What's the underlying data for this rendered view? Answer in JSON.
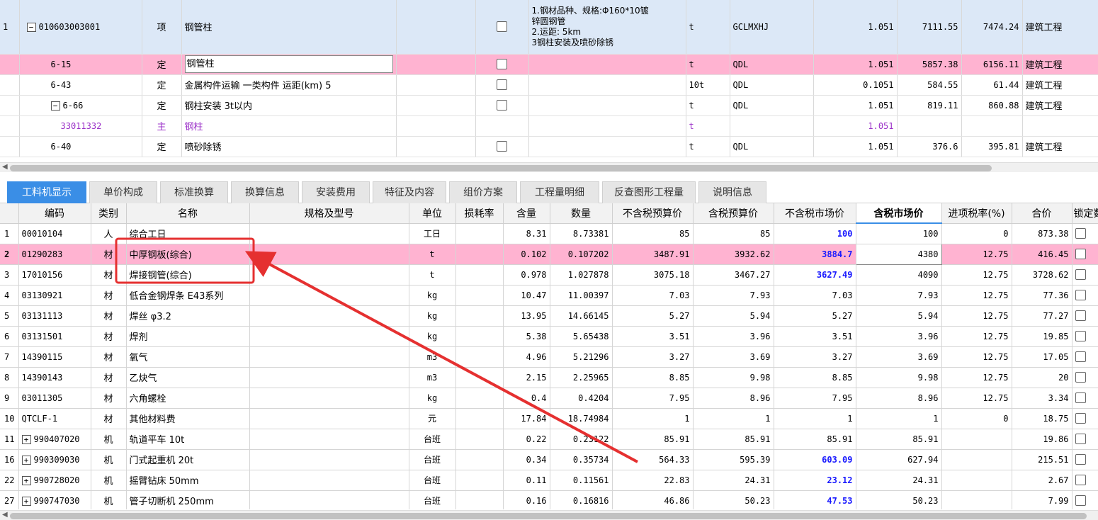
{
  "top_rows": [
    {
      "rownum": "1",
      "code": "010603003001",
      "type": "项",
      "name": "钢管柱",
      "desc": [
        "1.钢材品种、规格:Φ160*10镀",
        "锌圆钢管",
        "2.运距: 5km",
        "3钢柱安装及喷砂除锈"
      ],
      "unit": "t",
      "tag": "GCLMXHJ",
      "qty": "1.051",
      "price": "7111.55",
      "total": "7474.24",
      "category": "建筑工程"
    },
    {
      "rownum": "",
      "code": "6-15",
      "type": "定",
      "name": "钢管柱",
      "unit": "t",
      "tag": "QDL",
      "qty": "1.051",
      "price": "5857.38",
      "total": "6156.11",
      "category": "建筑工程"
    },
    {
      "rownum": "",
      "code": "6-43",
      "type": "定",
      "name": "金属构件运输 一类构件 运距(km) 5",
      "unit": "10t",
      "tag": "QDL",
      "qty": "0.1051",
      "price": "584.55",
      "total": "61.44",
      "category": "建筑工程"
    },
    {
      "rownum": "",
      "code": "6-66",
      "type": "定",
      "name": "钢柱安装 3t以内",
      "unit": "t",
      "tag": "QDL",
      "qty": "1.051",
      "price": "819.11",
      "total": "860.88",
      "category": "建筑工程"
    },
    {
      "rownum": "",
      "code": "33011332",
      "type": "主",
      "name": "钢柱",
      "unit": "t",
      "tag": "",
      "qty": "1.051",
      "price": "",
      "total": "",
      "category": ""
    },
    {
      "rownum": "",
      "code": "6-40",
      "type": "定",
      "name": "喷砂除锈",
      "unit": "t",
      "tag": "QDL",
      "qty": "1.051",
      "price": "376.6",
      "total": "395.81",
      "category": "建筑工程"
    }
  ],
  "tabs": [
    "工料机显示",
    "单价构成",
    "标准换算",
    "换算信息",
    "安装费用",
    "特征及内容",
    "组价方案",
    "工程量明细",
    "反查图形工程量",
    "说明信息"
  ],
  "columns": [
    "编码",
    "类别",
    "名称",
    "规格及型号",
    "单位",
    "损耗率",
    "含量",
    "数量",
    "不含税预算价",
    "含税预算价",
    "不含税市场价",
    "含税市场价",
    "进项税率(%)",
    "合价",
    "锁定数"
  ],
  "rows": [
    {
      "n": "1",
      "code": "00010104",
      "type": "人",
      "name": "综合工日",
      "unit": "工日",
      "content": "8.31",
      "qty": "8.73381",
      "p1": "85",
      "p2": "85",
      "p3": "100",
      "p4": "100",
      "tax": "0",
      "total": "873.38",
      "blue": true
    },
    {
      "n": "2",
      "code": "01290283",
      "type": "材",
      "name": "中厚钢板(综合)",
      "unit": "t",
      "content": "0.102",
      "qty": "0.107202",
      "p1": "3487.91",
      "p2": "3932.62",
      "p3": "3884.7",
      "p4": "4380",
      "tax": "12.75",
      "total": "416.45",
      "blue": true
    },
    {
      "n": "3",
      "code": "17010156",
      "type": "材",
      "name": "焊接钢管(综合)",
      "unit": "t",
      "content": "0.978",
      "qty": "1.027878",
      "p1": "3075.18",
      "p2": "3467.27",
      "p3": "3627.49",
      "p4": "4090",
      "tax": "12.75",
      "total": "3728.62",
      "blue": true
    },
    {
      "n": "4",
      "code": "03130921",
      "type": "材",
      "name": "低合金钢焊条 E43系列",
      "unit": "kg",
      "content": "10.47",
      "qty": "11.00397",
      "p1": "7.03",
      "p2": "7.93",
      "p3": "7.03",
      "p4": "7.93",
      "tax": "12.75",
      "total": "77.36",
      "blue": false
    },
    {
      "n": "5",
      "code": "03131113",
      "type": "材",
      "name": "焊丝 φ3.2",
      "unit": "kg",
      "content": "13.95",
      "qty": "14.66145",
      "p1": "5.27",
      "p2": "5.94",
      "p3": "5.27",
      "p4": "5.94",
      "tax": "12.75",
      "total": "77.27",
      "blue": false
    },
    {
      "n": "6",
      "code": "03131501",
      "type": "材",
      "name": "焊剂",
      "unit": "kg",
      "content": "5.38",
      "qty": "5.65438",
      "p1": "3.51",
      "p2": "3.96",
      "p3": "3.51",
      "p4": "3.96",
      "tax": "12.75",
      "total": "19.85",
      "blue": false
    },
    {
      "n": "7",
      "code": "14390115",
      "type": "材",
      "name": "氧气",
      "unit": "m3",
      "content": "4.96",
      "qty": "5.21296",
      "p1": "3.27",
      "p2": "3.69",
      "p3": "3.27",
      "p4": "3.69",
      "tax": "12.75",
      "total": "17.05",
      "blue": false
    },
    {
      "n": "8",
      "code": "14390143",
      "type": "材",
      "name": "乙炔气",
      "unit": "m3",
      "content": "2.15",
      "qty": "2.25965",
      "p1": "8.85",
      "p2": "9.98",
      "p3": "8.85",
      "p4": "9.98",
      "tax": "12.75",
      "total": "20",
      "blue": false
    },
    {
      "n": "9",
      "code": "03011305",
      "type": "材",
      "name": "六角螺栓",
      "unit": "kg",
      "content": "0.4",
      "qty": "0.4204",
      "p1": "7.95",
      "p2": "8.96",
      "p3": "7.95",
      "p4": "8.96",
      "tax": "12.75",
      "total": "3.34",
      "blue": false
    },
    {
      "n": "10",
      "code": "QTCLF-1",
      "type": "材",
      "name": "其他材料费",
      "unit": "元",
      "content": "17.84",
      "qty": "18.74984",
      "p1": "1",
      "p2": "1",
      "p3": "1",
      "p4": "1",
      "tax": "0",
      "total": "18.75",
      "blue": false
    },
    {
      "n": "11",
      "code": "990407020",
      "type": "机",
      "name": "轨道平车 10t",
      "unit": "台班",
      "content": "0.22",
      "qty": "0.23122",
      "p1": "85.91",
      "p2": "85.91",
      "p3": "85.91",
      "p4": "85.91",
      "tax": "",
      "total": "19.86",
      "blue": false,
      "expand": true
    },
    {
      "n": "16",
      "code": "990309030",
      "type": "机",
      "name": "门式起重机 20t",
      "unit": "台班",
      "content": "0.34",
      "qty": "0.35734",
      "p1": "564.33",
      "p2": "595.39",
      "p3": "603.09",
      "p4": "627.94",
      "tax": "",
      "total": "215.51",
      "blue": true,
      "expand": true
    },
    {
      "n": "22",
      "code": "990728020",
      "type": "机",
      "name": "摇臂钻床 50mm",
      "unit": "台班",
      "content": "0.11",
      "qty": "0.11561",
      "p1": "22.83",
      "p2": "24.31",
      "p3": "23.12",
      "p4": "24.31",
      "tax": "",
      "total": "2.67",
      "blue": true,
      "expand": true
    },
    {
      "n": "27",
      "code": "990747030",
      "type": "机",
      "name": "管子切断机 250mm",
      "unit": "台班",
      "content": "0.16",
      "qty": "0.16816",
      "p1": "46.86",
      "p2": "50.23",
      "p3": "47.53",
      "p4": "50.23",
      "tax": "",
      "total": "7.99",
      "blue": true,
      "expand": true
    }
  ]
}
